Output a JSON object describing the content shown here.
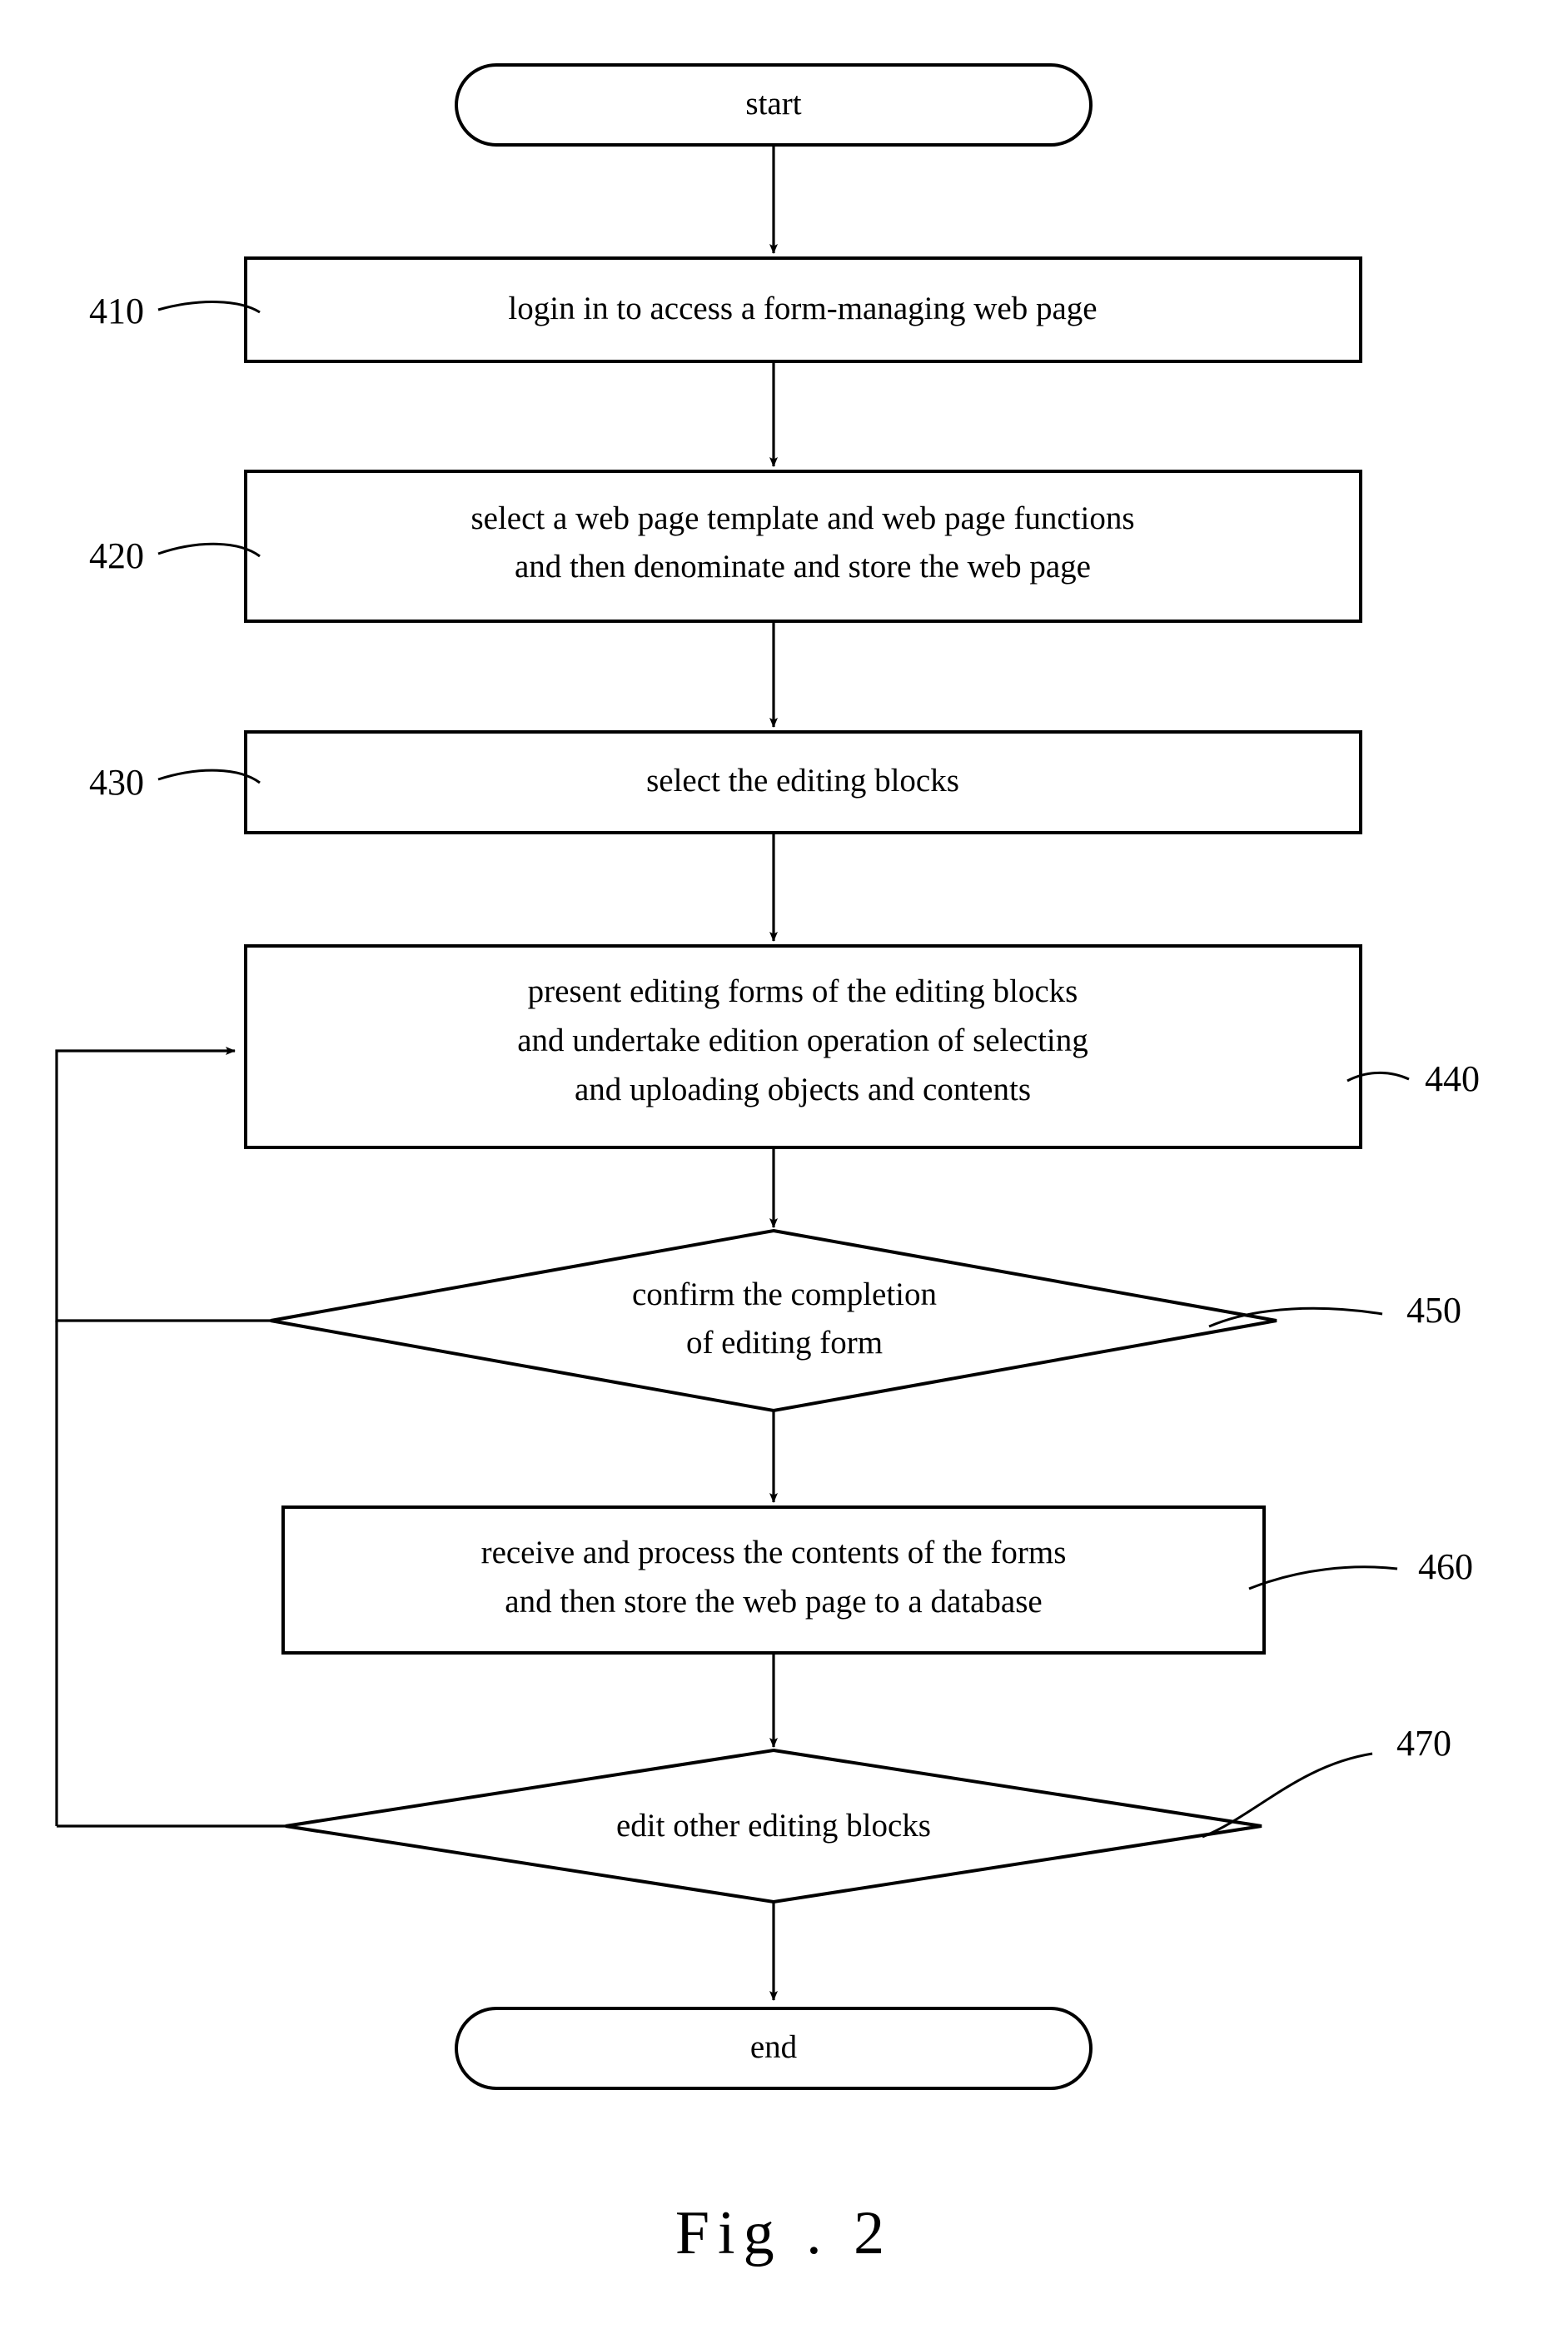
{
  "figure": {
    "caption": "Fig . 2",
    "title": "Flowchart of web page form editing method"
  },
  "nodes": {
    "start": {
      "id": "start",
      "type": "terminator",
      "label": "start"
    },
    "step410": {
      "id": "410",
      "type": "process",
      "ref": "410",
      "lines": [
        "login in to access a form-managing web page"
      ]
    },
    "step420": {
      "id": "420",
      "type": "process",
      "ref": "420",
      "lines": [
        "select a web page template and web page functions",
        "and then denominate and store the web page"
      ]
    },
    "step430": {
      "id": "430",
      "type": "process",
      "ref": "430",
      "lines": [
        "select the editing blocks"
      ]
    },
    "step440": {
      "id": "440",
      "type": "process",
      "ref": "440",
      "lines": [
        "present editing forms of the editing blocks",
        "and undertake edition operation of selecting",
        "and uploading objects and contents"
      ]
    },
    "step450": {
      "id": "450",
      "type": "decision",
      "ref": "450",
      "lines": [
        "confirm the completion",
        "of editing form"
      ]
    },
    "step460": {
      "id": "460",
      "type": "process",
      "ref": "460",
      "lines": [
        "receive and process the contents of the forms",
        "and then store the web page to a database"
      ]
    },
    "step470": {
      "id": "470",
      "type": "decision",
      "ref": "470",
      "lines": [
        "edit other editing blocks"
      ]
    },
    "end": {
      "id": "end",
      "type": "terminator",
      "label": "end"
    }
  },
  "edges": [
    {
      "from": "start",
      "to": "410",
      "kind": "arrow-down"
    },
    {
      "from": "410",
      "to": "420",
      "kind": "arrow-down"
    },
    {
      "from": "420",
      "to": "430",
      "kind": "arrow-down"
    },
    {
      "from": "430",
      "to": "440",
      "kind": "arrow-down"
    },
    {
      "from": "440",
      "to": "450",
      "kind": "arrow-down"
    },
    {
      "from": "450",
      "to": "460",
      "kind": "arrow-down"
    },
    {
      "from": "460",
      "to": "470",
      "kind": "arrow-down"
    },
    {
      "from": "470",
      "to": "end",
      "kind": "arrow-down"
    },
    {
      "from": "450",
      "to": "440",
      "kind": "feedback-left"
    },
    {
      "from": "470",
      "to": "440",
      "kind": "feedback-left"
    }
  ],
  "style": {
    "stroke": "#000000",
    "background": "#ffffff"
  }
}
